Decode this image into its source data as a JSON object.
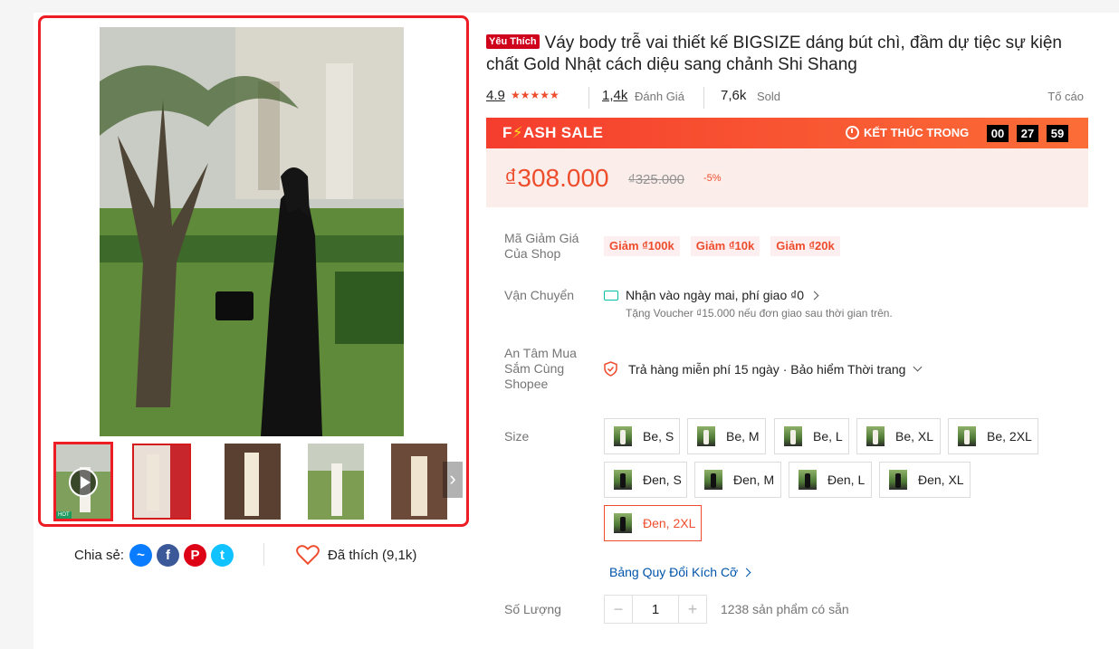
{
  "product": {
    "badge": "Yêu Thích",
    "title": "Váy body trễ vai thiết kế BIGSIZE dáng bút chì, đầm dự tiệc sự kiện chất Gold Nhật cách diệu sang chảnh Shi Shang",
    "rating": "4.9",
    "stars": "★★★★★",
    "reviews_count": "1,4k",
    "reviews_label": "Đánh Giá",
    "sold_count": "7,6k",
    "sold_label": "Sold",
    "report_label": "Tố cáo"
  },
  "flash_sale": {
    "title_prefix": "F",
    "bolt": "⚡",
    "title_suffix": "ASH SALE",
    "ends_label": "KẾT THÚC TRONG",
    "hours": "00",
    "minutes": "27",
    "seconds": "59"
  },
  "price": {
    "current": "₫308.000",
    "original": "₫325.000",
    "discount": "-5%"
  },
  "vouchers": {
    "label": "Mã Giảm Giá Của Shop",
    "items": [
      "Giảm ₫100k",
      "Giảm ₫10k",
      "Giảm ₫20k"
    ]
  },
  "shipping": {
    "label": "Vận Chuyển",
    "main": "Nhận vào ngày mai, phí giao ₫0",
    "sub": "Tặng Voucher ₫15.000 nếu đơn giao sau thời gian trên."
  },
  "guarantee": {
    "label": "An Tâm Mua Sắm Cùng Shopee",
    "text": "Trả hàng miễn phí 15 ngày · Bảo hiểm Thời trang"
  },
  "size": {
    "label": "Size",
    "options": [
      "Be, S",
      "Be, M",
      "Be, L",
      "Be, XL",
      "Be, 2XL",
      "Đen, S",
      "Đen, M",
      "Đen, L",
      "Đen, XL",
      "Đen, 2XL"
    ],
    "selected": "Đen, 2XL",
    "chart_link": "Bảng Quy Đổi Kích Cỡ"
  },
  "quantity": {
    "label": "Số Lượng",
    "minus": "−",
    "value": "1",
    "plus": "+",
    "stock": "1238 sản phẩm có sẵn"
  },
  "share": {
    "label": "Chia sẻ:",
    "messenger": "~",
    "facebook": "f",
    "pinterest": "P",
    "twitter": "t"
  },
  "like": {
    "label": "Đã thích (9,1k)"
  },
  "thumbnails": {
    "next": "›",
    "tag": "HOT"
  },
  "colors": {
    "accent": "#ee4d2d",
    "gallery_border": "#ee1c25",
    "link": "#0055aa"
  }
}
